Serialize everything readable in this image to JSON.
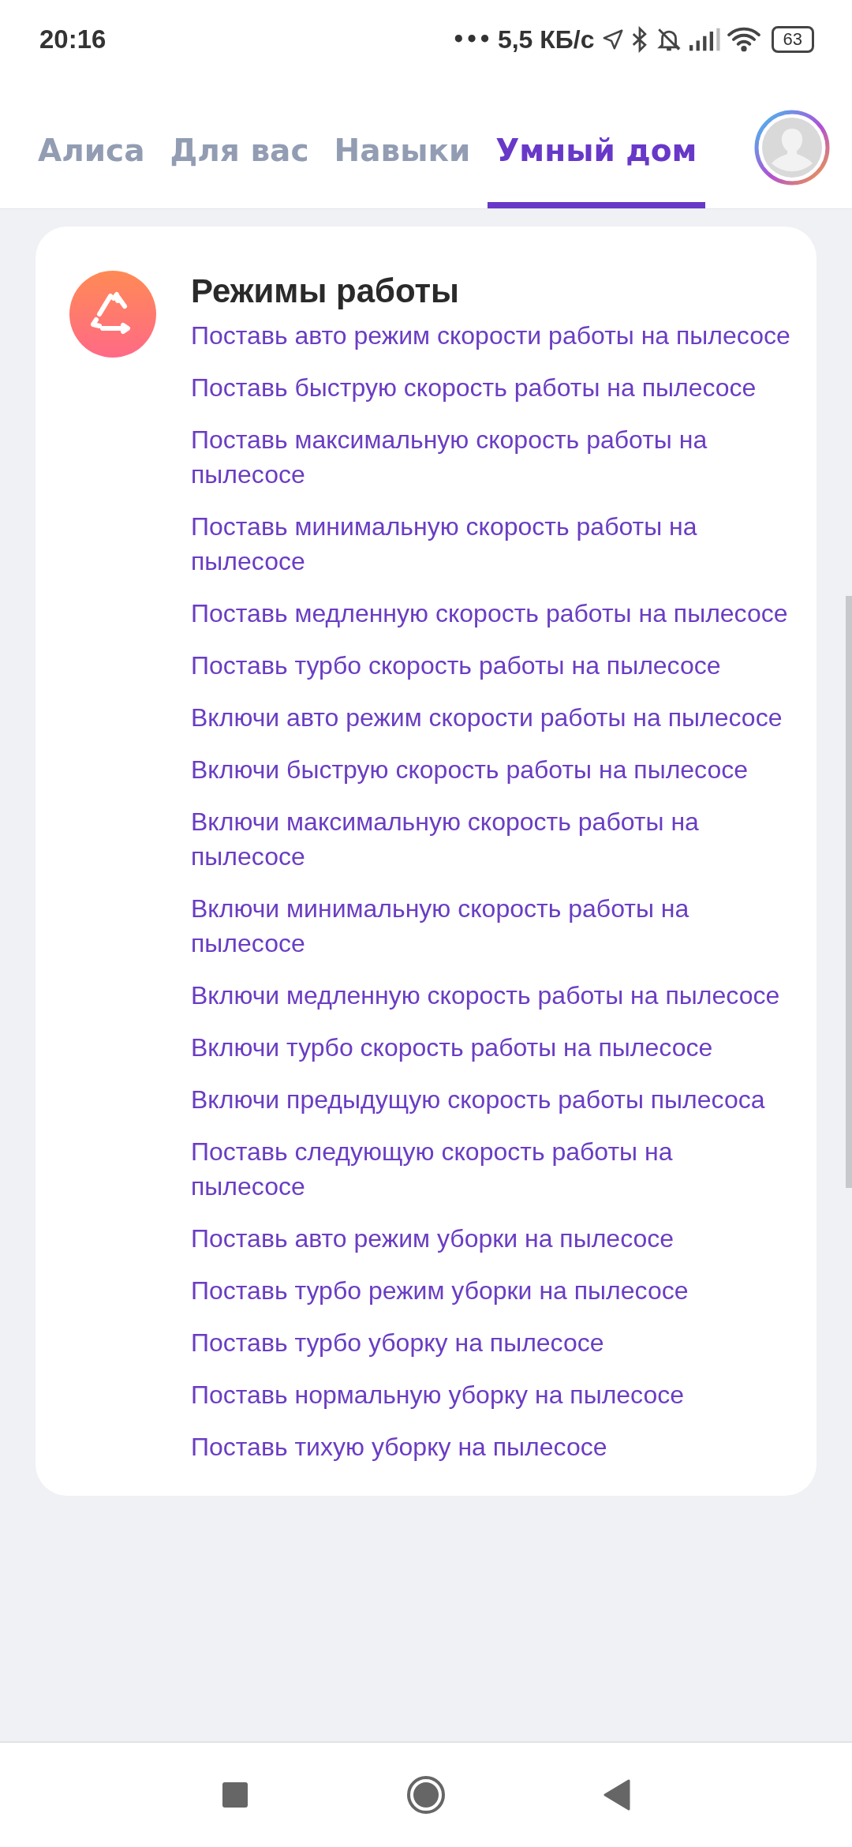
{
  "status_bar": {
    "time": "20:16",
    "dots": "•••",
    "speed": "5,5 КБ/с",
    "battery": "63"
  },
  "tabs": [
    {
      "label": "Алиса",
      "selected": false
    },
    {
      "label": "Для вас",
      "selected": false
    },
    {
      "label": "Навыки",
      "selected": false
    },
    {
      "label": "Умный дом",
      "selected": true
    }
  ],
  "card": {
    "title": "Режимы работы",
    "commands": [
      "Поставь авто режим скорости работы на пылесосе",
      "Поставь быструю скорость работы на пылесосе",
      "Поставь максимальную скорость работы на пылесосе",
      "Поставь минимальную скорость работы на пылесосе",
      "Поставь медленную скорость работы на пылесосе",
      "Поставь турбо скорость работы на пылесосе",
      "Включи авто режим скорости работы на пылесосе",
      "Включи быструю скорость работы на пылесосе",
      "Включи максимальную скорость работы на пылесосе",
      "Включи минимальную скорость работы на пылесосе",
      "Включи медленную скорость работы на пылесосе",
      "Включи турбо скорость работы на пылесосе",
      "Включи предыдущую скорость работы пылесоса",
      "Поставь следующую скорость работы на пылесосе",
      "Поставь авто режим уборки на пылесосе",
      "Поставь турбо режим уборки на пылесосе",
      "Поставь турбо уборку на пылесосе",
      "Поставь нормальную уборку на пылесосе",
      "Поставь тихую уборку на пылесосе"
    ]
  }
}
